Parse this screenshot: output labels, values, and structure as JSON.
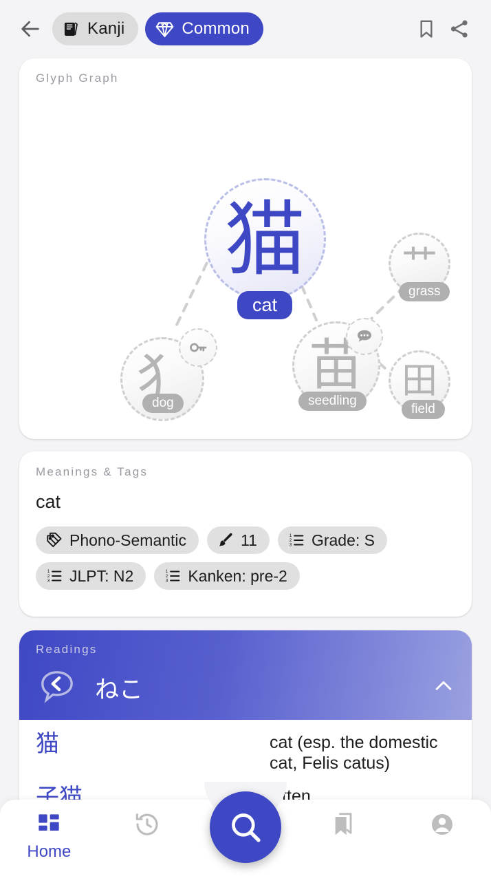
{
  "topbar": {
    "back_icon": "arrow-left-icon",
    "chips": [
      {
        "icon": "book-icon",
        "label": "Kanji",
        "style": "grey"
      },
      {
        "icon": "diamond-icon",
        "label": "Common",
        "style": "blue"
      }
    ],
    "actions": [
      {
        "icon": "bookmark-icon"
      },
      {
        "icon": "share-icon"
      }
    ]
  },
  "graph": {
    "title": "Glyph Graph",
    "main": {
      "glyph": "猫",
      "label": "cat"
    },
    "nodes": [
      {
        "glyph": "犭",
        "label": "dog",
        "badge": "key-icon"
      },
      {
        "glyph": "苗",
        "label": "seedling",
        "badge": "speech-bubble-icon"
      },
      {
        "glyph": "艹",
        "label": "grass",
        "badge": ""
      },
      {
        "glyph": "田",
        "label": "field",
        "badge": ""
      }
    ],
    "edges": [
      {
        "from": "cat",
        "to": "dog"
      },
      {
        "from": "cat",
        "to": "seedling"
      },
      {
        "from": "seedling",
        "to": "grass"
      },
      {
        "from": "seedling",
        "to": "field"
      }
    ]
  },
  "meanings": {
    "title": "Meanings & Tags",
    "meaning": "cat",
    "tags": [
      {
        "icon": "tags-icon",
        "label": "Phono-Semantic"
      },
      {
        "icon": "brush-icon",
        "label": "11"
      },
      {
        "icon": "numbered-list-icon",
        "label": "Grade: S"
      },
      {
        "icon": "numbered-list-icon",
        "label": "JLPT: N2"
      },
      {
        "icon": "numbered-list-icon",
        "label": "Kanken: pre-2"
      }
    ]
  },
  "readings": {
    "title": "Readings",
    "reading_icon": "kun-reading-bubble-icon",
    "reading": "ねこ",
    "collapse_icon": "chevron-up-icon",
    "words": [
      {
        "jp": "猫",
        "en": "cat (esp. the domestic cat, Felis catus)"
      },
      {
        "jp": "子猫",
        "en": "kitten"
      }
    ]
  },
  "fab": {
    "icon": "search-icon"
  },
  "bottom_nav": {
    "items": [
      {
        "icon": "dashboard-icon",
        "label": "Home",
        "active": true
      },
      {
        "icon": "history-icon",
        "label": "",
        "active": false
      },
      {
        "icon": "collections-icon",
        "label": "",
        "active": false
      },
      {
        "icon": "account-icon",
        "label": "",
        "active": false
      }
    ]
  },
  "colors": {
    "accent": "#3f48c4",
    "page_bg": "#f4f4f6",
    "card_bg": "#ffffff",
    "muted": "#b0b0b0"
  }
}
